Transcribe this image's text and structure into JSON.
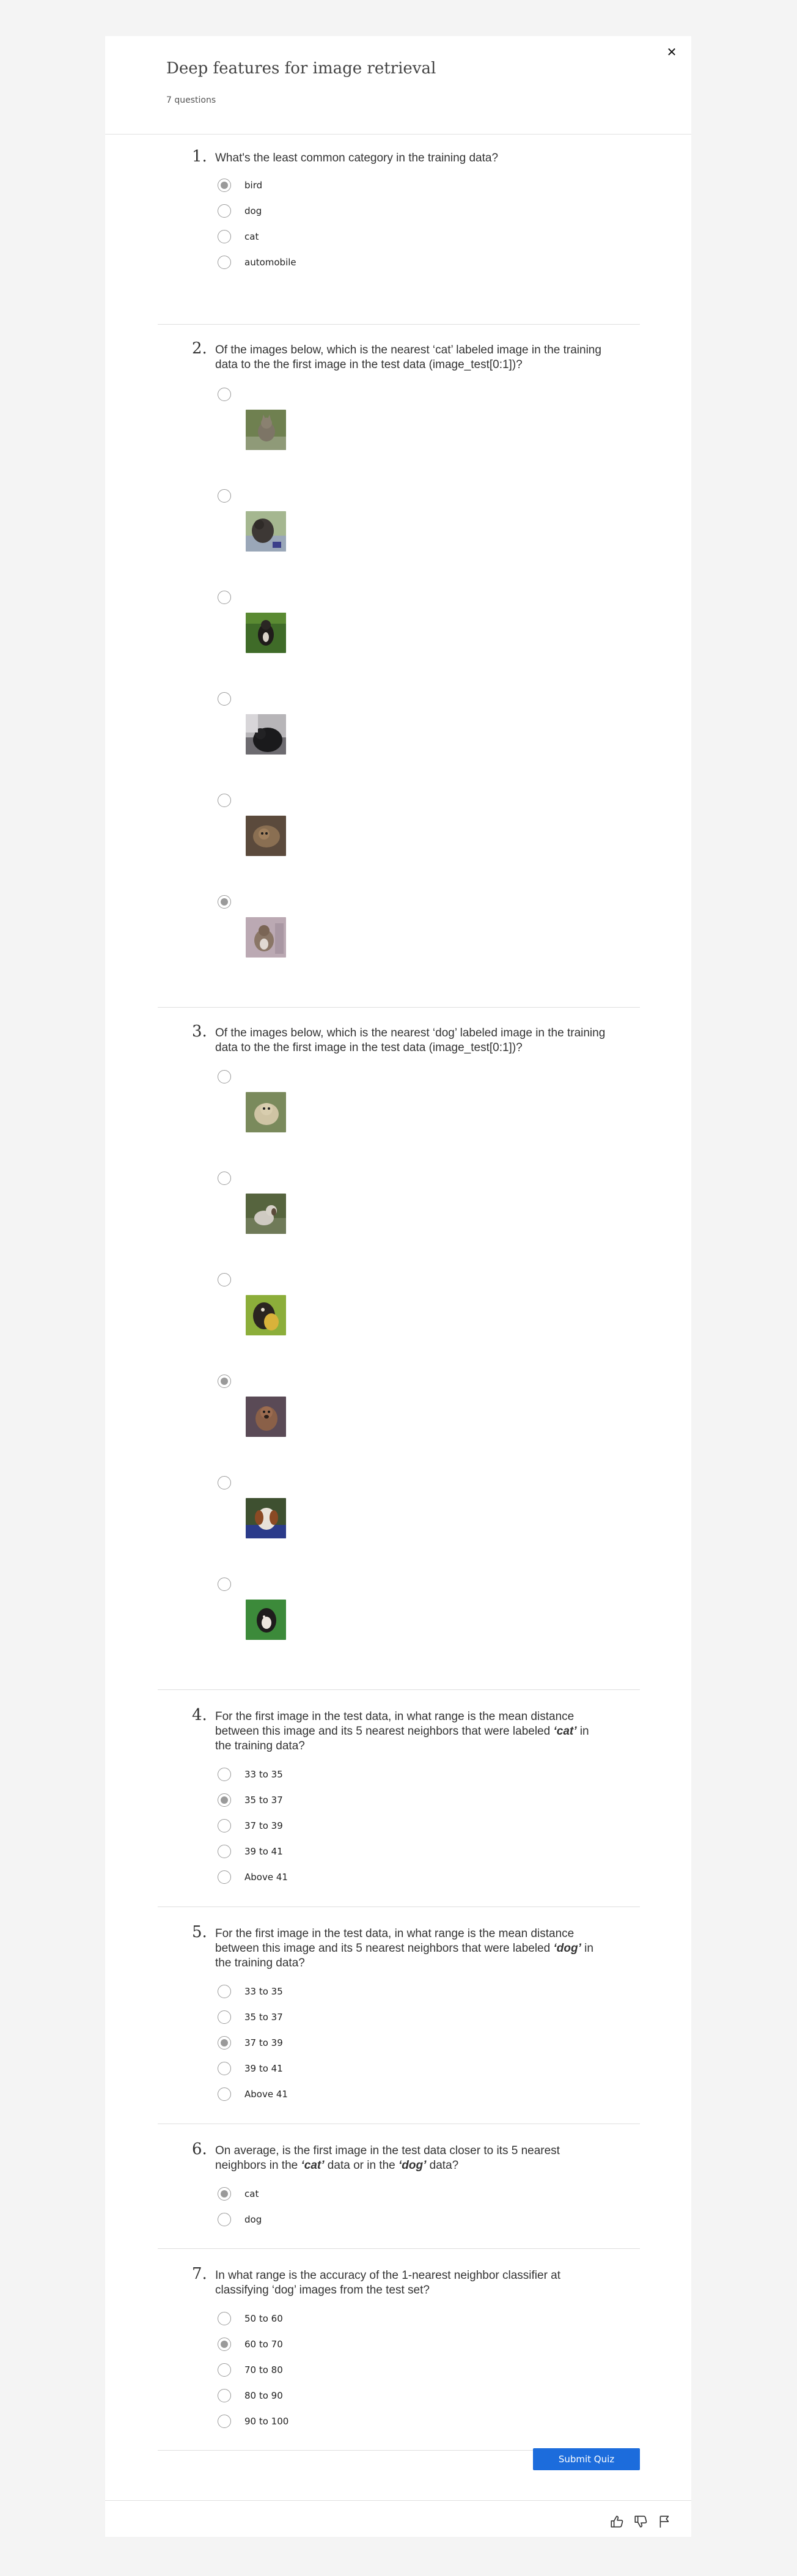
{
  "quiz": {
    "title": "Deep features for image retrieval",
    "count": "7 questions",
    "submit_label": "Submit Quiz"
  },
  "questions": [
    {
      "number": "1.",
      "text": "What's the least common category in the training data?",
      "options": [
        "bird",
        "dog",
        "cat",
        "automobile"
      ],
      "selected": 0
    },
    {
      "number": "2.",
      "text": "Of the images below, which is the nearest ‘cat’ labeled image in the training data to the the first image in the test data (image_test[0:1])?",
      "options": [
        {
          "image": "cat-photo-1"
        },
        {
          "image": "cat-photo-2"
        },
        {
          "image": "cat-photo-3"
        },
        {
          "image": "cat-photo-4"
        },
        {
          "image": "cat-photo-5"
        },
        {
          "image": "cat-photo-6"
        }
      ],
      "selected": 5
    },
    {
      "number": "3.",
      "text": "Of the images below, which is the nearest ‘dog’ labeled image in the training data to the the first image in the test data (image_test[0:1])?",
      "options": [
        {
          "image": "dog-photo-1"
        },
        {
          "image": "dog-photo-2"
        },
        {
          "image": "dog-photo-3"
        },
        {
          "image": "dog-photo-4"
        },
        {
          "image": "dog-photo-5"
        },
        {
          "image": "dog-photo-6"
        }
      ],
      "selected": 3
    },
    {
      "number": "4.",
      "text_parts": [
        "For the first image in the test data, in what range is the mean distance between this image and its 5 nearest neighbors that were labeled ",
        "‘cat’",
        " in the training data?"
      ],
      "options": [
        "33 to 35",
        "35 to 37",
        "37 to 39",
        "39 to 41",
        "Above 41"
      ],
      "selected": 1
    },
    {
      "number": "5.",
      "text_parts": [
        "For the first image in the test data, in what range is the mean distance between this image and its 5 nearest neighbors that were labeled ",
        "‘dog’",
        " in the training data?"
      ],
      "options": [
        "33 to 35",
        "35 to 37",
        "37 to 39",
        "39 to 41",
        "Above 41"
      ],
      "selected": 2
    },
    {
      "number": "6.",
      "text_parts": [
        "On average, is the first image in the test data closer to its 5 nearest neighbors in the ",
        "‘cat’",
        " data or in the ",
        "‘dog’",
        " data?"
      ],
      "options": [
        "cat",
        "dog"
      ],
      "selected": 0
    },
    {
      "number": "7.",
      "text": "In what range is the accuracy of the 1-nearest neighbor classifier at classifying ‘dog’ images from the test set?",
      "options": [
        "50 to 60",
        "60 to 70",
        "70 to 80",
        "80 to 90",
        "90 to 100"
      ],
      "selected": 1
    }
  ],
  "icons": {
    "close": "close-icon",
    "thumbs_up": "thumbs-up-icon",
    "thumbs_down": "thumbs-down-icon",
    "flag": "flag-icon"
  },
  "colors": {
    "accent": "#1c6cdc",
    "radio_selected": "#9a9a9a",
    "background": "#f4f4f4"
  }
}
